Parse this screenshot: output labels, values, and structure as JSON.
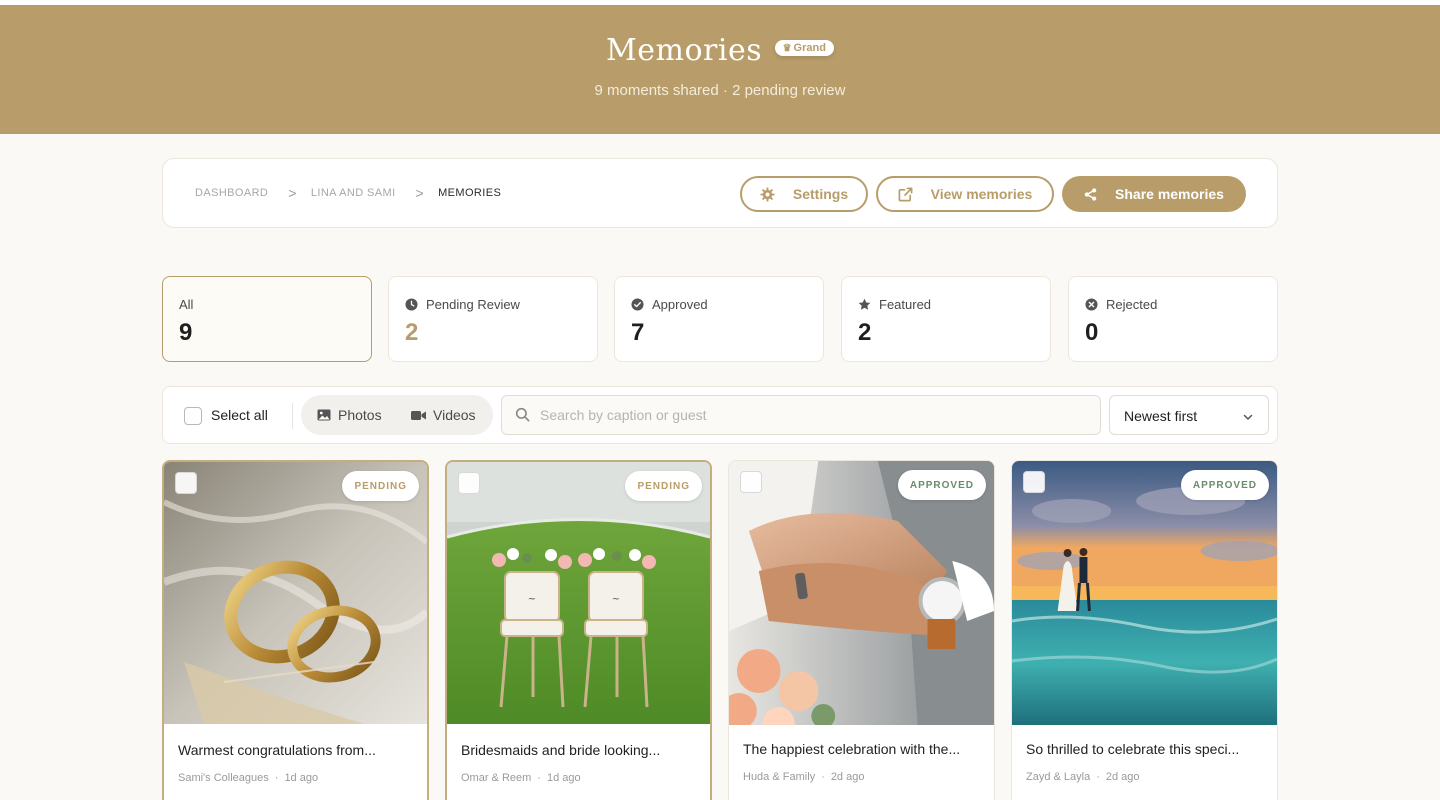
{
  "hero": {
    "title": "Memories",
    "badge": "Grand",
    "subtitle": "9  moments shared · 2 pending review"
  },
  "breadcrumb": {
    "items": [
      "DASHBOARD",
      "LINA AND SAMI",
      "MEMORIES"
    ],
    "separator": ">"
  },
  "actions": {
    "settings": "Settings",
    "view": "View memories",
    "share": "Share memories"
  },
  "stats": [
    {
      "label": "All",
      "value": "9"
    },
    {
      "label": "Pending Review",
      "value": "2"
    },
    {
      "label": "Approved",
      "value": "7"
    },
    {
      "label": "Featured",
      "value": "2"
    },
    {
      "label": "Rejected",
      "value": "0"
    }
  ],
  "toolbar": {
    "select_all": "Select all",
    "photos": "Photos",
    "videos": "Videos",
    "search_placeholder": "Search by caption or guest",
    "sort": "Newest first"
  },
  "cards": [
    {
      "status": "PENDING",
      "caption": "Warmest congratulations from...",
      "author": "Sami's Colleagues",
      "time": "1d ago",
      "image": "wedding-rings"
    },
    {
      "status": "PENDING",
      "caption": "Bridesmaids and bride looking...",
      "author": "Omar & Reem",
      "time": "1d ago",
      "image": "decorated-chairs-on-lawn"
    },
    {
      "status": "APPROVED",
      "caption": "The happiest celebration with the...",
      "author": "Huda & Family",
      "time": "2d ago",
      "image": "couple-hands-with-rings"
    },
    {
      "status": "APPROVED",
      "caption": "So thrilled to celebrate this speci...",
      "author": "Zayd & Layla",
      "time": "2d ago",
      "image": "couple-on-beach-sunset"
    }
  ],
  "colors": {
    "brand": "#b89d6a",
    "background": "#faf9f6",
    "approved": "#6a8c6a"
  }
}
